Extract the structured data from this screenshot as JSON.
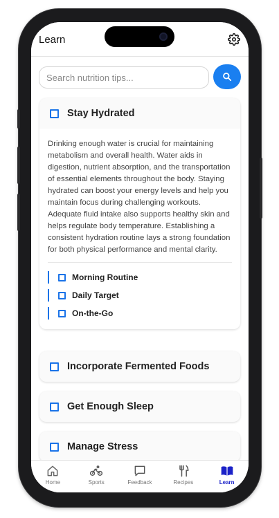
{
  "header": {
    "title": "Learn",
    "settings_icon": "gear-icon"
  },
  "search": {
    "placeholder": "Search nutrition tips...",
    "button_icon": "search-icon"
  },
  "topics": [
    {
      "title": "Stay Hydrated",
      "expanded": true,
      "body": "Drinking enough water is crucial for maintaining metabolism and overall health. Water aids in digestion, nutrient absorption, and the transportation of essential elements throughout the body. Staying hydrated can boost your energy levels and help you maintain focus during challenging workouts. Adequate fluid intake also supports healthy skin and helps regulate body temperature. Establishing a consistent hydration routine lays a strong foundation for both physical performance and mental clarity.",
      "subtopics": [
        {
          "label": "Morning Routine"
        },
        {
          "label": "Daily Target"
        },
        {
          "label": "On-the-Go"
        }
      ]
    },
    {
      "title": "Incorporate Fermented Foods",
      "expanded": false
    },
    {
      "title": "Get Enough Sleep",
      "expanded": false
    },
    {
      "title": "Manage Stress",
      "expanded": false
    }
  ],
  "tabbar": {
    "active": "Learn",
    "tabs": [
      {
        "label": "Home",
        "icon": "home-icon"
      },
      {
        "label": "Sports",
        "icon": "bicycle-icon"
      },
      {
        "label": "Feedback",
        "icon": "chat-icon"
      },
      {
        "label": "Recipes",
        "icon": "utensils-icon"
      },
      {
        "label": "Learn",
        "icon": "book-icon"
      }
    ]
  },
  "colors": {
    "accent": "#1a7ff0",
    "active_tab": "#1b22c8",
    "checkbox": "#1a73e8"
  }
}
